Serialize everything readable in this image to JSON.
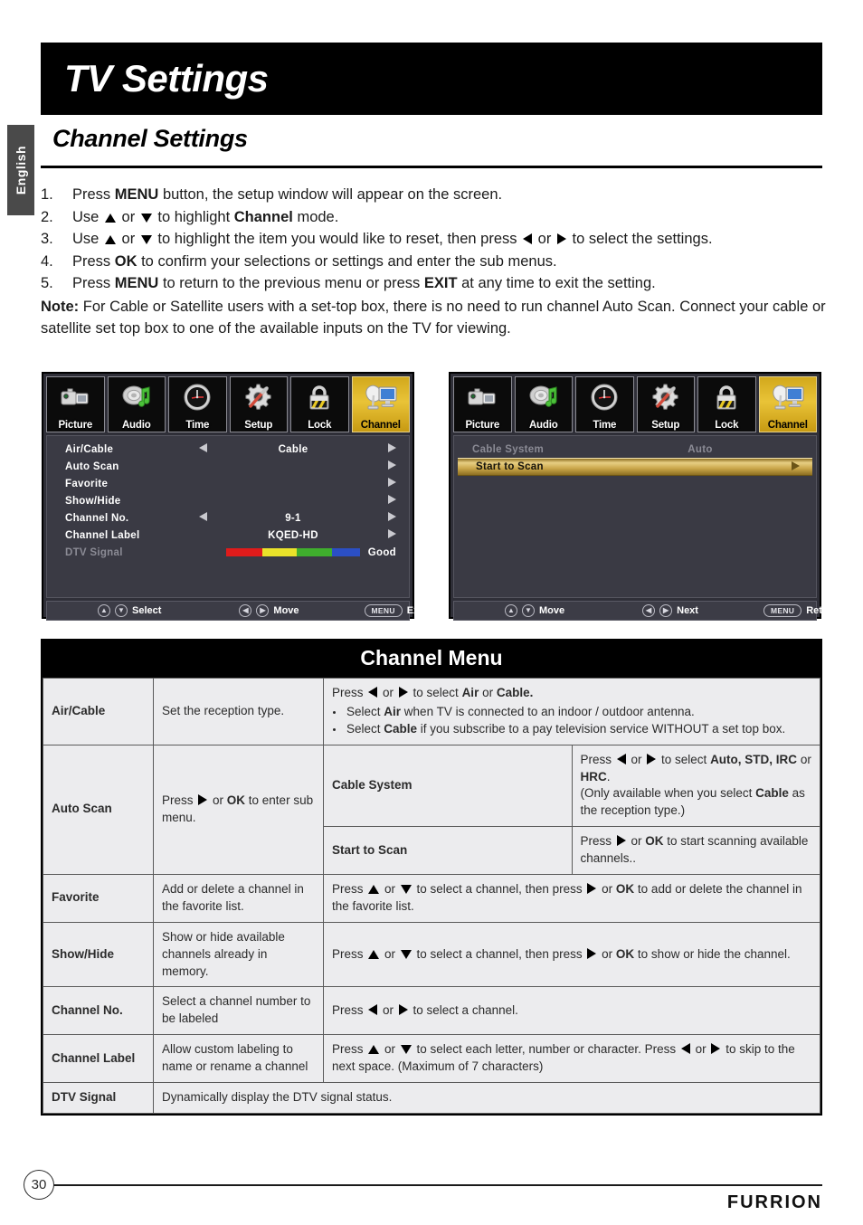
{
  "language_tab": "English",
  "header": {
    "title": "TV Settings"
  },
  "section": {
    "title": "Channel Settings"
  },
  "steps": [
    {
      "num": "1.",
      "html": "Press <b>MENU</b> button, the setup window will appear on the screen."
    },
    {
      "num": "2.",
      "html": "Use <span class=\"tri-u\"></span> or <span class=\"tri-d\"></span> to highlight <b>Channel</b> mode."
    },
    {
      "num": "3.",
      "html": "Use <span class=\"tri-u\"></span> or <span class=\"tri-d\"></span> to highlight the item you would like to reset, then press <span class=\"tri-l\"></span> or <span class=\"tri-r\"></span> to select the settings."
    },
    {
      "num": "4.",
      "html": "Press <b>OK</b> to confirm your selections or settings and enter the sub menus."
    },
    {
      "num": "5.",
      "html": "Press <b>MENU</b> to return to the previous menu or press <b>EXIT</b> at any time to exit the setting."
    }
  ],
  "note_html": "<b>Note:</b> For Cable or Satellite users with a set-top box, there is no need to run channel Auto Scan. Connect your cable or satellite set top box to one of the available inputs on the TV for viewing.",
  "osd_tabs": [
    {
      "label": "Picture",
      "icon": "camcorder-icon",
      "active": false
    },
    {
      "label": "Audio",
      "icon": "speaker-note-icon",
      "active": false
    },
    {
      "label": "Time",
      "icon": "clock-icon",
      "active": false
    },
    {
      "label": "Setup",
      "icon": "gear-screwdriver-icon",
      "active": false
    },
    {
      "label": "Lock",
      "icon": "padlock-icon",
      "active": false
    },
    {
      "label": "Channel",
      "icon": "satellite-tv-icon",
      "active": true
    }
  ],
  "osd_left": {
    "rows": [
      {
        "label": "Air/Cable",
        "value": "Cable",
        "left_arrow": true,
        "right_arrow": true,
        "dim": false
      },
      {
        "label": "Auto Scan",
        "value": "",
        "left_arrow": false,
        "right_arrow": true,
        "dim": false
      },
      {
        "label": "Favorite",
        "value": "",
        "left_arrow": false,
        "right_arrow": true,
        "dim": false
      },
      {
        "label": "Show/Hide",
        "value": "",
        "left_arrow": false,
        "right_arrow": true,
        "dim": false
      },
      {
        "label": "Channel No.",
        "value": "9-1",
        "left_arrow": true,
        "right_arrow": true,
        "dim": false
      },
      {
        "label": "Channel Label",
        "value": "KQED-HD",
        "left_arrow": false,
        "right_arrow": true,
        "dim": false
      },
      {
        "label": "DTV Signal",
        "value": "",
        "left_arrow": false,
        "right_arrow": false,
        "dim": true,
        "signal_bar": true,
        "signal_text": "Good"
      }
    ],
    "footer": [
      {
        "keys": "updown",
        "label": "Select"
      },
      {
        "keys": "leftright",
        "label": "Move"
      },
      {
        "keys": "menu",
        "key_label": "MENU",
        "label": "Exit"
      }
    ]
  },
  "osd_right": {
    "rows": [
      {
        "label": "Cable System",
        "value": "Auto",
        "dim": true,
        "highlight": false,
        "right_arrow": false
      },
      {
        "label": "Start to Scan",
        "value": "",
        "dim": false,
        "highlight": true,
        "right_arrow": true
      }
    ],
    "footer": [
      {
        "keys": "updown",
        "label": "Move"
      },
      {
        "keys": "leftright",
        "label": "Next"
      },
      {
        "keys": "menu",
        "key_label": "MENU",
        "label": "Return"
      }
    ]
  },
  "table": {
    "title": "Channel Menu",
    "rows": [
      {
        "key": "Air/Cable",
        "desc": "Set the reception type.",
        "detail_html": "Press <span class=\"tri-l\"></span> or <span class=\"tri-r\"></span> to select <b>Air</b> or <b>Cable.</b><ul><li>Select <b>Air</b> when TV is connected to an indoor / outdoor antenna.</li><li>Select <b>Cable</b> if you subscribe to a pay television service WITHOUT a set top box.</li></ul>"
      },
      {
        "key": "Auto Scan",
        "desc_html": "Press <span class=\"tri-r\"></span> or <b>OK</b> to enter sub menu.",
        "subrows": [
          {
            "sub_key": "Cable System",
            "detail_html": "Press <span class=\"tri-l\"></span> or <span class=\"tri-r\"></span> to select <b>Auto, STD, IRC</b> or <b>HRC</b>.<br>(Only available when you select <b>Cable</b> as the reception type.)"
          },
          {
            "sub_key": "Start to Scan",
            "detail_html": "Press <span class=\"tri-r\"></span> or <b>OK</b> to start scanning available channels.."
          }
        ]
      },
      {
        "key": "Favorite",
        "desc": "Add or delete a channel in the favorite list.",
        "detail_html": "Press <span class=\"tri-u\"></span> or <span class=\"tri-d\"></span> to select a channel, then press <span class=\"tri-r\"></span> or <b>OK</b> to add or delete the channel in the favorite list."
      },
      {
        "key": "Show/Hide",
        "desc": "Show or hide available channels already in memory.",
        "detail_html": "Press <span class=\"tri-u\"></span> or <span class=\"tri-d\"></span> to select a channel, then press <span class=\"tri-r\"></span> or <b>OK</b> to show or hide the channel."
      },
      {
        "key": "Channel No.",
        "desc": "Select a channel number to be labeled",
        "detail_html": "Press <span class=\"tri-l\"></span> or <span class=\"tri-r\"></span> to select a channel."
      },
      {
        "key": "Channel Label",
        "desc": "Allow custom labeling to name or rename a channel",
        "detail_html": "Press <span class=\"tri-u\"></span> or <span class=\"tri-d\"></span> to select each letter, number or character. Press <span class=\"tri-l\"></span> or <span class=\"tri-r\"></span> to skip to the next space. (Maximum of 7 characters)"
      },
      {
        "key": "DTV Signal",
        "desc_full": "Dynamically display the DTV signal status."
      }
    ]
  },
  "footer": {
    "page_number": "30",
    "brand": "FURRION"
  }
}
